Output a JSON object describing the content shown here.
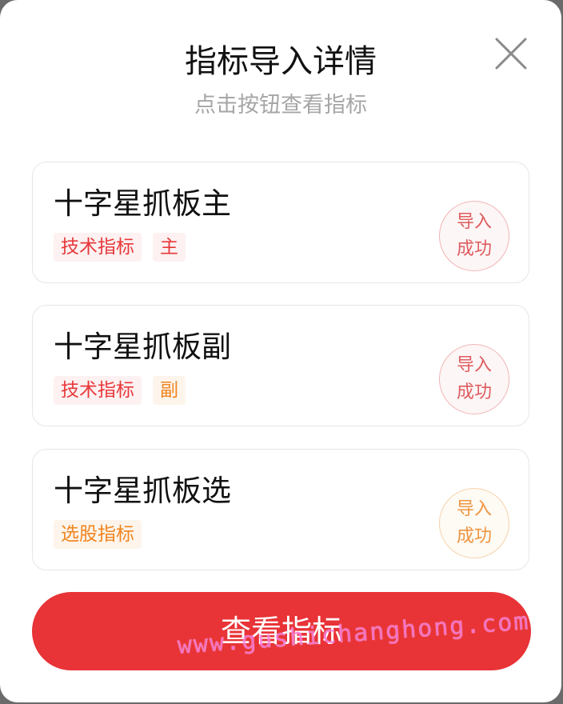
{
  "dialog": {
    "title": "指标导入详情",
    "subtitle": "点击按钮查看指标"
  },
  "items": [
    {
      "name": "十字星抓板主",
      "tags": [
        {
          "label": "技术指标",
          "color": "#e8383b"
        },
        {
          "label": "主",
          "color": "#e8383b"
        }
      ],
      "status": {
        "line1": "导入",
        "line2": "成功",
        "color": "#de5c5f"
      }
    },
    {
      "name": "十字星抓板副",
      "tags": [
        {
          "label": "技术指标",
          "color": "#e8383b"
        },
        {
          "label": "副",
          "color": "#f0841f"
        }
      ],
      "status": {
        "line1": "导入",
        "line2": "成功",
        "color": "#de5c5f"
      }
    },
    {
      "name": "十字星抓板选",
      "tags": [
        {
          "label": "选股指标",
          "color": "#f0841f"
        }
      ],
      "status": {
        "line1": "导入",
        "line2": "成功",
        "color": "#ee9540"
      }
    }
  ],
  "primary_button": {
    "label": "查看指标",
    "color": "#e83337"
  },
  "watermark": "www.gushichanghong.com",
  "icons": {
    "close": "close-icon"
  }
}
